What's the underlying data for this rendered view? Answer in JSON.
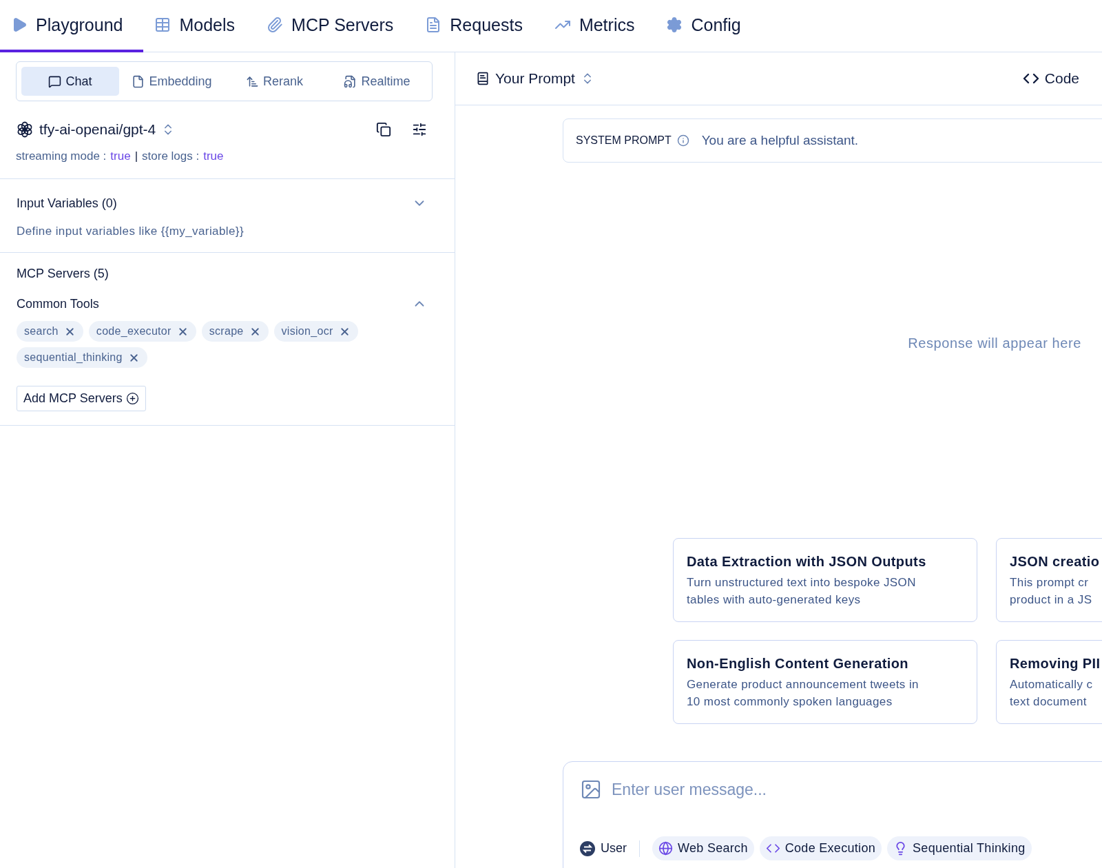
{
  "nav": {
    "tabs": [
      {
        "label": "Playground",
        "selected": true
      },
      {
        "label": "Models",
        "selected": false
      },
      {
        "label": "MCP Servers",
        "selected": false
      },
      {
        "label": "Requests",
        "selected": false
      },
      {
        "label": "Metrics",
        "selected": false
      },
      {
        "label": "Config",
        "selected": false
      }
    ]
  },
  "modes": [
    {
      "label": "Chat",
      "selected": true
    },
    {
      "label": "Embedding",
      "selected": false
    },
    {
      "label": "Rerank",
      "selected": false
    },
    {
      "label": "Realtime",
      "selected": false
    }
  ],
  "model": {
    "name": "tfy-ai-openai/gpt-4",
    "separator": "|",
    "settings": [
      {
        "label": "streaming mode :",
        "value": "true"
      },
      {
        "label": "store logs :",
        "value": "true"
      }
    ]
  },
  "input_variables": {
    "title": "Input Variables (0)",
    "expanded": false,
    "hint": "Define input variables like {{my_variable}}"
  },
  "mcp_servers": {
    "title": "MCP Servers (5)",
    "groups": [
      {
        "name": "Common Tools",
        "expanded": true,
        "tools": [
          "search",
          "code_executor",
          "scrape",
          "vision_ocr",
          "sequential_thinking"
        ]
      }
    ],
    "add_button": "Add MCP Servers"
  },
  "prompt_header": {
    "selector": "Your Prompt",
    "code_button": "Code"
  },
  "system_prompt": {
    "label": "SYSTEM PROMPT",
    "value": "You are a helpful assistant."
  },
  "response_placeholder": "Response will appear here",
  "suggestions": [
    {
      "title": "Data Extraction with JSON Outputs",
      "description": [
        "Turn unstructured text into bespoke JSON",
        "tables with auto-generated keys"
      ]
    },
    {
      "title": "JSON creatio",
      "description": [
        "This prompt cr",
        "product in a JS"
      ]
    },
    {
      "title": "Non-English Content Generation",
      "description": [
        "Generate product announcement tweets in",
        "10 most commonly spoken languages"
      ]
    },
    {
      "title": "Removing PII",
      "description": [
        "Automatically c",
        "text document"
      ]
    }
  ],
  "composer": {
    "placeholder": "Enter user message...",
    "role": "User",
    "tools": [
      "Web Search",
      "Code Execution",
      "Sequential Thinking"
    ]
  }
}
